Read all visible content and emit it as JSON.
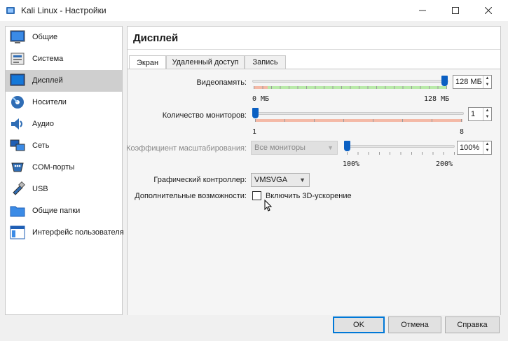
{
  "window": {
    "title": "Kali Linux - Настройки",
    "icons": [
      "virtualbox-icon",
      "minimize-icon",
      "maximize-icon",
      "close-icon"
    ]
  },
  "sidebar": {
    "items": [
      {
        "label": "Общие",
        "icon": "general-icon"
      },
      {
        "label": "Система",
        "icon": "system-icon"
      },
      {
        "label": "Дисплей",
        "icon": "display-icon",
        "active": true
      },
      {
        "label": "Носители",
        "icon": "storage-icon"
      },
      {
        "label": "Аудио",
        "icon": "audio-icon"
      },
      {
        "label": "Сеть",
        "icon": "network-icon"
      },
      {
        "label": "COM-порты",
        "icon": "serial-port-icon"
      },
      {
        "label": "USB",
        "icon": "usb-icon"
      },
      {
        "label": "Общие папки",
        "icon": "shared-folders-icon"
      },
      {
        "label": "Интерфейс пользователя",
        "icon": "user-interface-icon"
      }
    ]
  },
  "main": {
    "title": "Дисплей",
    "tabs": [
      {
        "label": "Экран",
        "active": true
      },
      {
        "label": "Удаленный доступ"
      },
      {
        "label": "Запись"
      }
    ],
    "screen": {
      "video_memory": {
        "label": "Видеопамять:",
        "value": "128 МБ",
        "min_label": "0 МБ",
        "max_label": "128 МБ",
        "fraction": 1.0
      },
      "monitors": {
        "label": "Количество мониторов:",
        "value": "1",
        "min_label": "1",
        "max_label": "8",
        "fraction": 0.0
      },
      "scale": {
        "label": "Коэффициент масштабирования:",
        "combo": "Все мониторы",
        "value": "100%",
        "min_label": "100%",
        "max_label": "200%",
        "fraction": 0.0
      },
      "graphics_controller": {
        "label": "Графический контроллер:",
        "value": "VMSVGA"
      },
      "extended": {
        "label": "Дополнительные возможности:",
        "checkbox_label": "Включить 3D-ускорение",
        "checked": false
      }
    }
  },
  "buttons": {
    "ok": "OK",
    "cancel": "Отмена",
    "help": "Справка"
  },
  "colors": {
    "accent": "#0a5fc2",
    "range_good": "#b9eaa9",
    "range_bad": "#f4b9a6"
  }
}
